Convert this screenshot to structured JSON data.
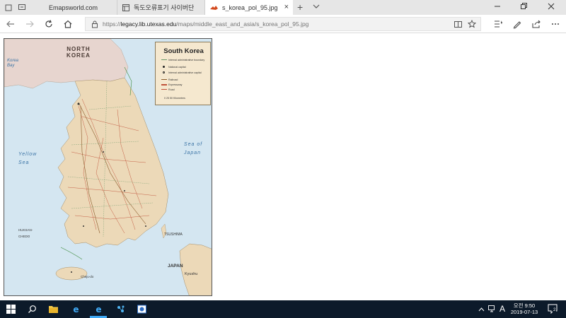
{
  "browser": {
    "tabs": [
      {
        "label": "Emapsworld.com",
        "icon": "page-icon",
        "active": false
      },
      {
        "label": "독도오류표기 사이버단 > 1",
        "icon": "reading-page-icon",
        "active": false
      },
      {
        "label": "s_korea_pol_95.jpg",
        "icon": "image-file-icon",
        "active": true
      }
    ],
    "tab_close_glyph": "×",
    "new_tab_glyph": "+",
    "address": {
      "url_prefix": "https://",
      "url_domain": "legacy.lib.utexas.edu",
      "url_path": "/maps/middle_east_and_asia/s_korea_pol_95.jpg"
    }
  },
  "map": {
    "title": "South Korea",
    "legend_rows": [
      "Internal administrative boundary",
      "National capital",
      "Internal administrative capital",
      "Railroad",
      "Expressway",
      "Road"
    ],
    "scale_label": "0     25     50 Kilometers",
    "labels": {
      "north_korea": "NORTH KOREA",
      "korea_bay": "Korea Bay",
      "yellow_sea": "Yellow Sea",
      "sea_of_japan": "Sea of Japan",
      "japan": "JAPAN",
      "tsushima": "TSUSHIMA",
      "kyushu": "Kyushu",
      "cheju": "Cheju-do",
      "hukuan": "HUKSAN-CHEDO"
    }
  },
  "taskbar": {
    "ime_label": "A",
    "time": "오전 9:50",
    "date": "2019-07-13",
    "notification_count": "2"
  },
  "colors": {
    "tabstrip": "#e6e6e6",
    "taskbar": "#0c1a2a",
    "sea": "#d4e6f1",
    "land": "#ecd9b8",
    "legend_bg": "#f5e8cf",
    "edge_blue": "#0a6cd6"
  }
}
